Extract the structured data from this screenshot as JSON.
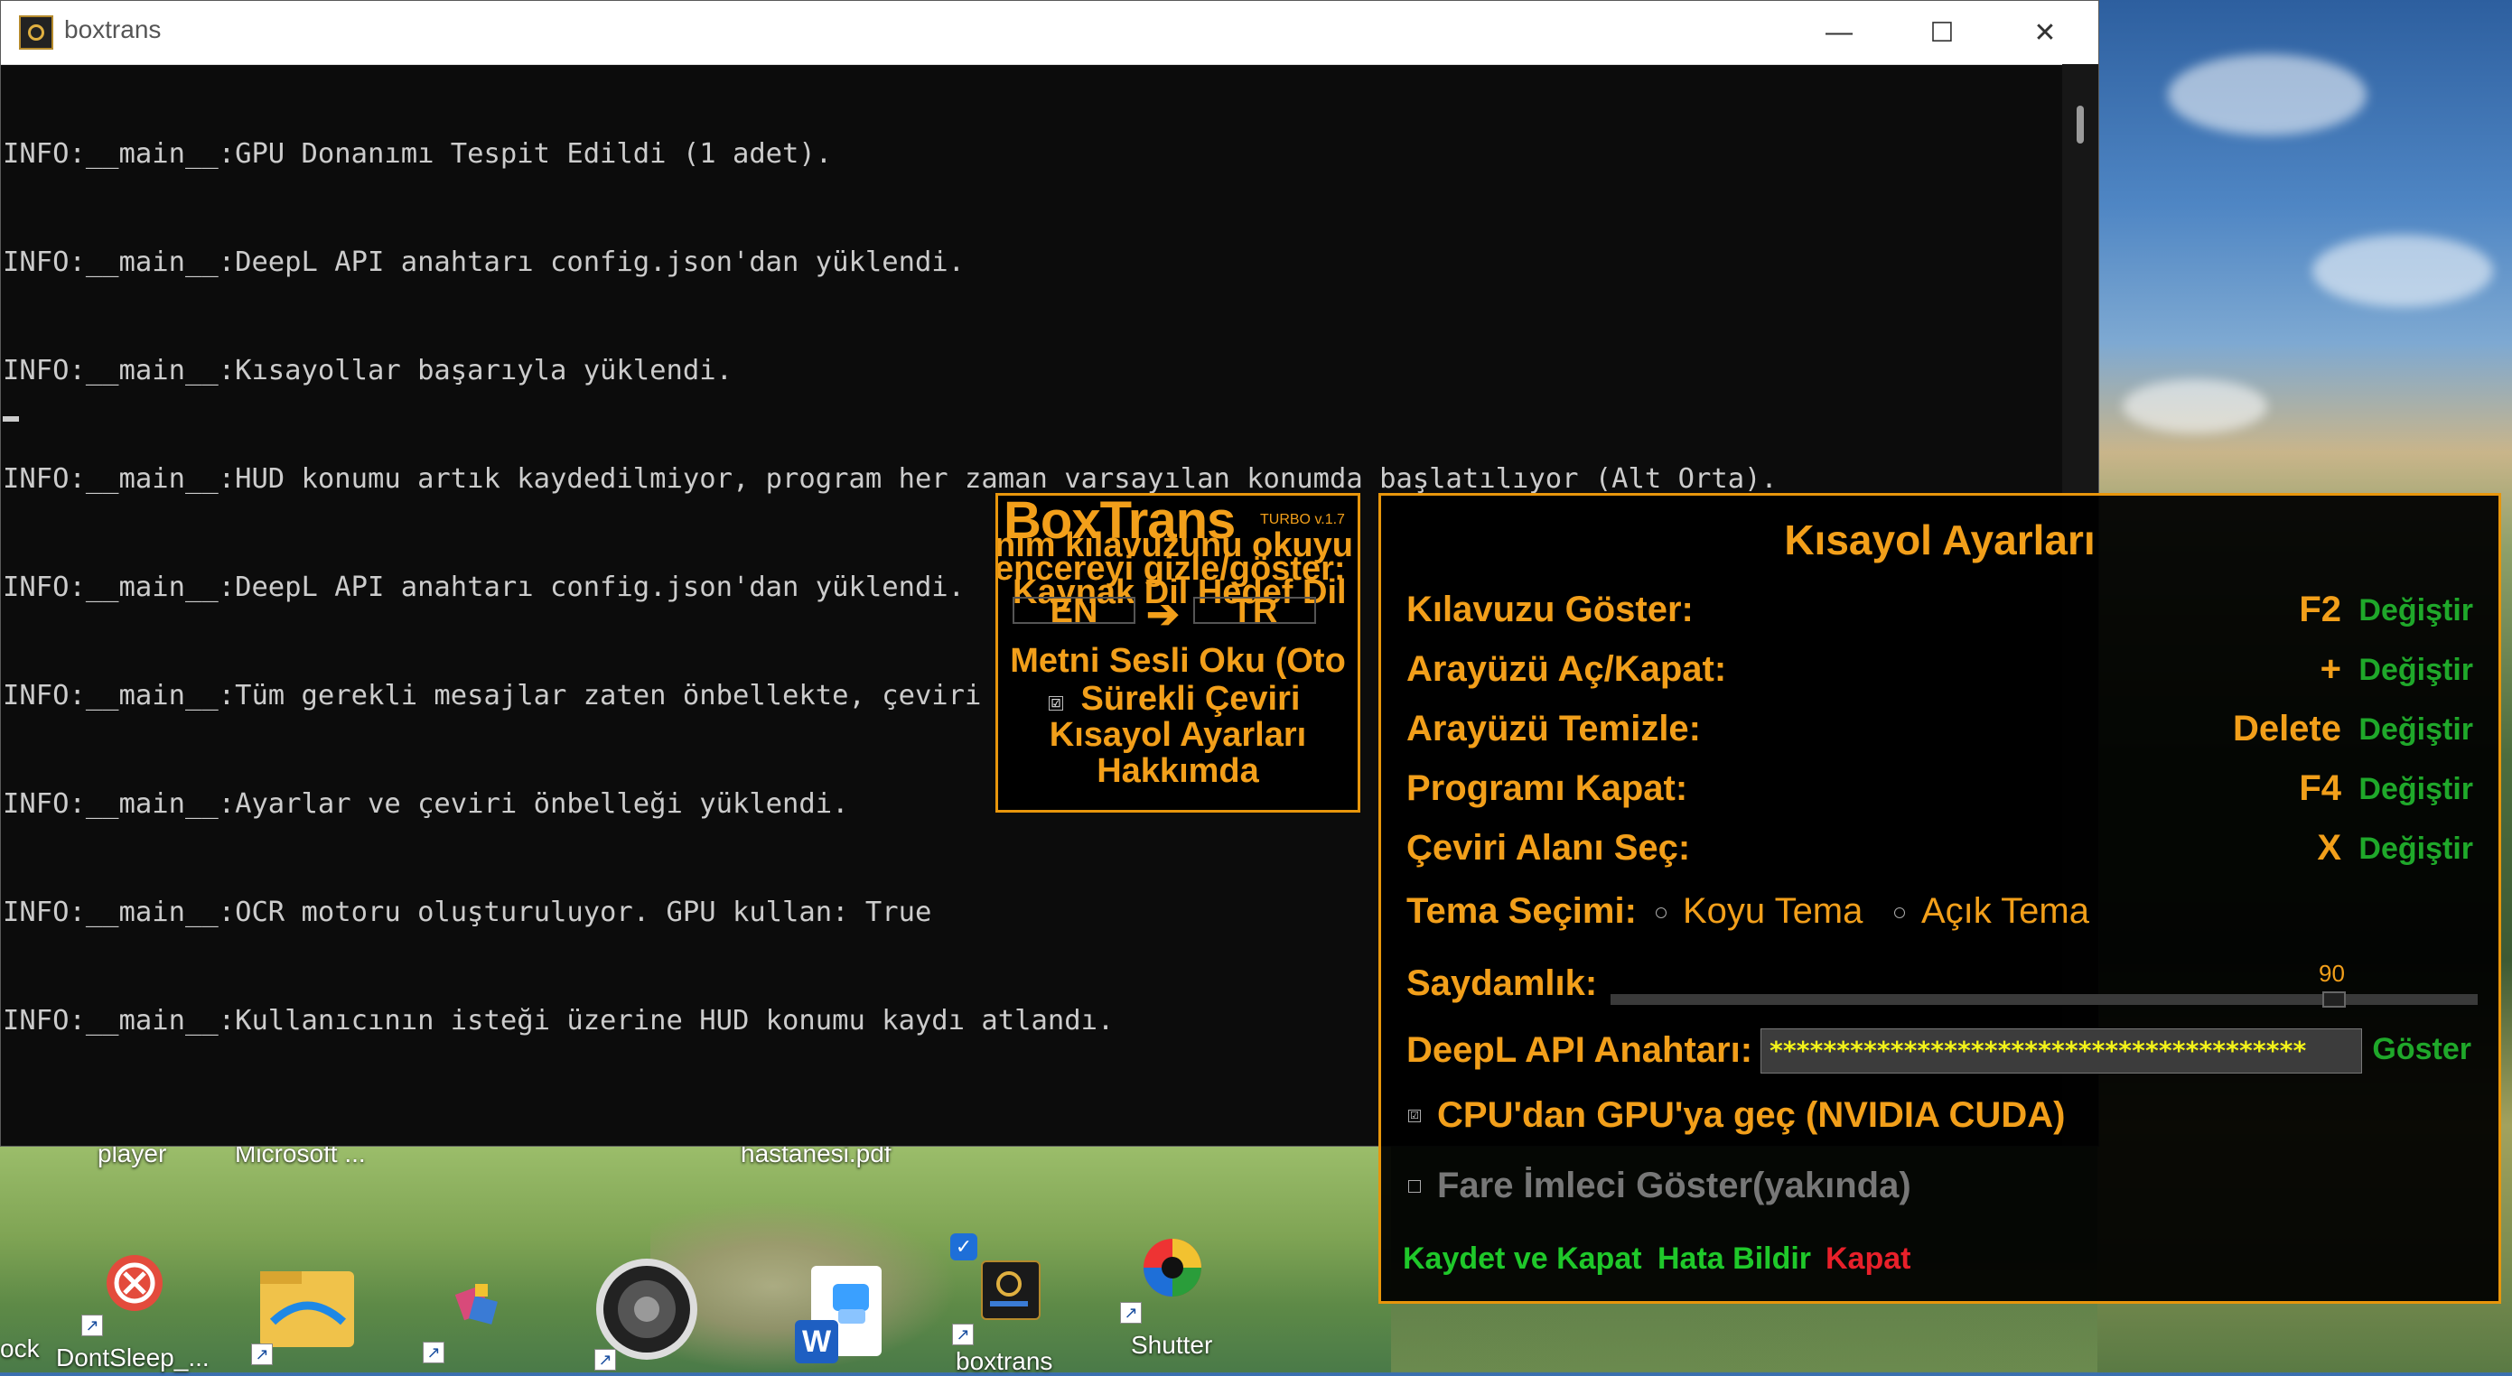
{
  "window": {
    "title": "boxtrans",
    "minimize": "—",
    "maximize": "☐",
    "close": "✕"
  },
  "console": {
    "lines": [
      "INFO:__main__:GPU Donanımı Tespit Edildi (1 adet).",
      "INFO:__main__:DeepL API anahtarı config.json'dan yüklendi.",
      "INFO:__main__:Kısayollar başarıyla yüklendi.",
      "INFO:__main__:HUD konumu artık kaydedilmiyor, program her zaman varsayılan konumda başlatılıyor (Alt Orta).",
      "INFO:__main__:DeepL API anahtarı config.json'dan yüklendi.",
      "INFO:__main__:Tüm gerekli mesajlar zaten önbellekte, çeviri isteği gönderilmedi.",
      "INFO:__main__:Ayarlar ve çeviri önbelleği yüklendi.",
      "INFO:__main__:OCR motoru oluşturuluyor. GPU kullan: True",
      "INFO:__main__:Kullanıcının isteği üzerine HUD konumu kaydı atlandı."
    ]
  },
  "hud": {
    "title": "BoxTrans",
    "version": "TURBO v.1.7",
    "ghost_guide": "nım kılavuzunu okuyu",
    "ghost_toggle": "encereyi gizle/göster:",
    "ghost_lang": "Kaynak Dil  Hedef Dil",
    "source_lang": "EN",
    "target_lang": "TR",
    "arrow": "➔",
    "read_aloud": "Metni Sesli Oku (Oto",
    "continuous": "Sürekli Çeviri",
    "continuous_check": "☑",
    "shortcut_settings": "Kısayol Ayarları",
    "about": "Hakkımda"
  },
  "panel": {
    "title": "Kısayol Ayarları",
    "rows": [
      {
        "label": "Kılavuzu Göster:",
        "key": "F2",
        "change": "Değiştir"
      },
      {
        "label": "Arayüzü Aç/Kapat:",
        "key": "+",
        "change": "Değiştir"
      },
      {
        "label": "Arayüzü Temizle:",
        "key": "Delete",
        "change": "Değiştir"
      },
      {
        "label": "Programı Kapat:",
        "key": "F4",
        "change": "Değiştir"
      },
      {
        "label": "Çeviri Alanı Seç:",
        "key": "X",
        "change": "Değiştir"
      }
    ],
    "theme_label": "Tema Seçimi:",
    "theme_dark": "Koyu Tema",
    "theme_light": "Açık Tema",
    "opacity_label": "Saydamlık:",
    "opacity_value": "90",
    "api_label": "DeepL API Anahtarı:",
    "api_value": "****************************************",
    "show_button": "Göster",
    "gpu_option": "CPU'dan GPU'ya geç (NVIDIA CUDA)",
    "gpu_checked": "☑",
    "cursor_option": "Fare İmleci Göster(yakında)",
    "save_close": "Kaydet ve Kapat",
    "report_bug": "Hata Bildir",
    "close": "Kapat",
    "colors": {
      "accent": "#f29f1a",
      "green": "#1fa82a",
      "red": "#e8202a"
    }
  },
  "desktop": {
    "labels": {
      "player": "player",
      "microsoft": "Microsoft ...",
      "hastanesi": "hastanesi.pdf",
      "lock": "ock",
      "dontsleep": "DontSleep_...",
      "boxtrans": "boxtrans",
      "shutter": "Shutter"
    },
    "icons": [
      "dontsleep-icon",
      "file-explorer-icon",
      "paint-tool-icon",
      "speaker-icon",
      "word-icon",
      "boxtrans-icon",
      "shutter-icon"
    ]
  }
}
